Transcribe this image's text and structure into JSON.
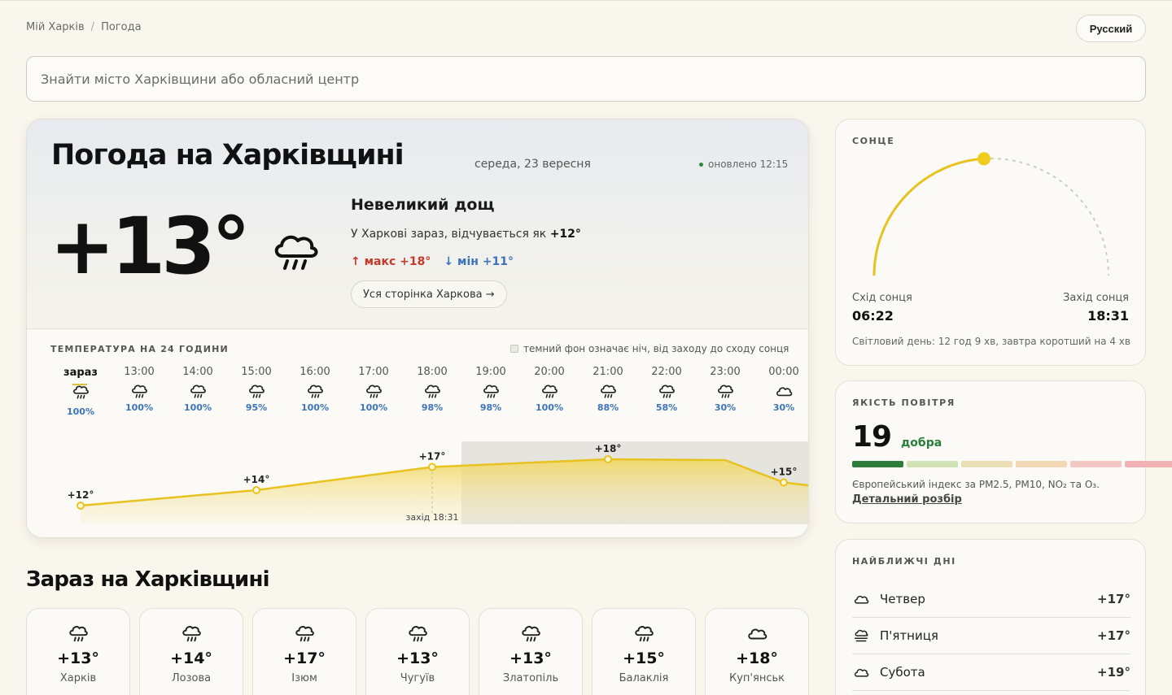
{
  "breadcrumb": {
    "home": "Мій Харків",
    "current": "Погода"
  },
  "lang_button": "Русский",
  "search": {
    "placeholder": "Знайти місто Харківщини або обласний центр"
  },
  "main": {
    "title": "Погода на Харківщині",
    "date": "середа, 23 вересня",
    "updated": "оновлено 12:15",
    "temp": "+13°",
    "condition": "Невеликий дощ",
    "feels_prefix": "У Харкові зараз, відчувається як",
    "feels_value": "+12°",
    "max": "↑ макс +18°",
    "min": "↓ мін +11°",
    "city_link": "Уся сторінка Харкова →",
    "weather_icon": "cloud-rain-icon"
  },
  "hourly": {
    "label": "ТЕМПЕРАТУРА НА 24 ГОДИНИ",
    "night_note": "темний фон означає ніч, від заходу до сходу сонця",
    "sunset_marker": "захід 18:31",
    "hours": [
      {
        "time": "зараз",
        "precip": "100%",
        "icon": "rain"
      },
      {
        "time": "13:00",
        "precip": "100%",
        "icon": "rain"
      },
      {
        "time": "14:00",
        "precip": "100%",
        "icon": "rain"
      },
      {
        "time": "15:00",
        "precip": "95%",
        "icon": "rain"
      },
      {
        "time": "16:00",
        "precip": "100%",
        "icon": "rain"
      },
      {
        "time": "17:00",
        "precip": "100%",
        "icon": "rain"
      },
      {
        "time": "18:00",
        "precip": "98%",
        "icon": "rain"
      },
      {
        "time": "19:00",
        "precip": "98%",
        "icon": "rain"
      },
      {
        "time": "20:00",
        "precip": "100%",
        "icon": "rain"
      },
      {
        "time": "21:00",
        "precip": "88%",
        "icon": "rain"
      },
      {
        "time": "22:00",
        "precip": "58%",
        "icon": "rain"
      },
      {
        "time": "23:00",
        "precip": "30%",
        "icon": "rain"
      },
      {
        "time": "00:00",
        "precip": "30%",
        "icon": "cloud"
      }
    ],
    "temp_labels": [
      {
        "hour_index": 0,
        "label": "+12°"
      },
      {
        "hour_index": 3,
        "label": "+14°"
      },
      {
        "hour_index": 6,
        "label": "+17°"
      },
      {
        "hour_index": 9,
        "label": "+18°"
      },
      {
        "hour_index": 12,
        "label": "+15°"
      }
    ]
  },
  "sun": {
    "label": "СОНЦЕ",
    "sunrise_label": "Схід сонця",
    "sunrise": "06:22",
    "sunset_label": "Захід сонця",
    "sunset": "18:31",
    "daylight": "Світловий день: 12 год 9 хв, завтра коротший на 4 хв",
    "day_progress": 0.48
  },
  "air": {
    "label": "ЯКІСТЬ ПОВІТРЯ",
    "value": "19",
    "rating": "добра",
    "scale_colors": [
      "#2f7d3a",
      "#cfe3b4",
      "#ecdfb6",
      "#f2d8b5",
      "#f3c7c2",
      "#f0b2b2"
    ],
    "description": "Європейський індекс за PM2.5, PM10, NO₂ та O₃.",
    "link": "Детальний розбір"
  },
  "days": {
    "label": "НАЙБЛИЖЧІ ДНІ",
    "items": [
      {
        "name": "Четвер",
        "temp": "+17°",
        "icon": "cloud"
      },
      {
        "name": "П'ятниця",
        "temp": "+17°",
        "icon": "fog"
      },
      {
        "name": "Субота",
        "temp": "+19°",
        "icon": "cloud"
      }
    ]
  },
  "now_section": {
    "title": "Зараз на Харківщині",
    "cities": [
      {
        "name": "Харків",
        "temp": "+13°",
        "icon": "rain"
      },
      {
        "name": "Лозова",
        "temp": "+14°",
        "icon": "rain"
      },
      {
        "name": "Ізюм",
        "temp": "+17°",
        "icon": "rain"
      },
      {
        "name": "Чугуїв",
        "temp": "+13°",
        "icon": "rain"
      },
      {
        "name": "Златопіль",
        "temp": "+13°",
        "icon": "rain"
      },
      {
        "name": "Балаклія",
        "temp": "+15°",
        "icon": "rain"
      },
      {
        "name": "Куп'янськ",
        "temp": "+18°",
        "icon": "cloud"
      }
    ]
  },
  "colors": {
    "accent": "#e8c21e",
    "max": "#c33a2a",
    "min": "#3b74b8",
    "good": "#2a7d3a"
  }
}
